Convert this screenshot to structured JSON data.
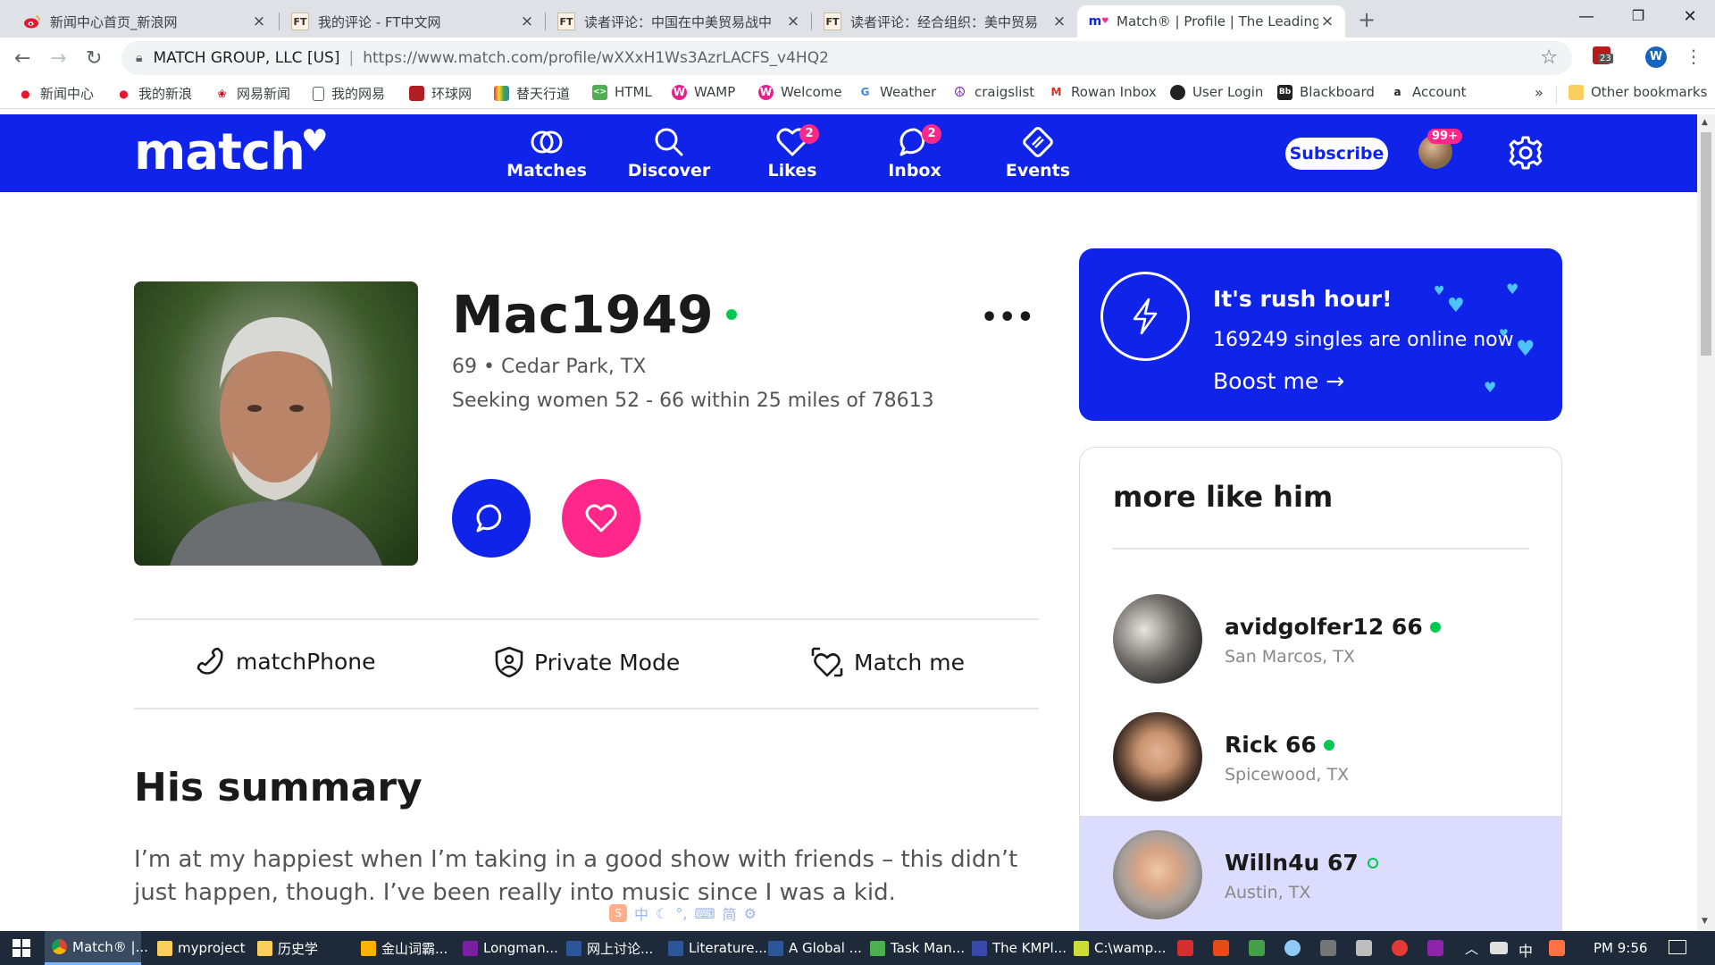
{
  "browser": {
    "tabs": [
      {
        "title": "新闻中心首页_新浪网",
        "favicon": "weibo-icon",
        "active": false
      },
      {
        "title": "我的评论 - FT中文网",
        "favicon": "ft-icon",
        "active": false
      },
      {
        "title": "读者评论：中国在中美贸易战中",
        "favicon": "ft-icon",
        "active": false
      },
      {
        "title": "读者评论：经合组织：美中贸易",
        "favicon": "ft-icon",
        "active": false
      },
      {
        "title": "Match® | Profile | The Leading O",
        "favicon": "match-icon",
        "active": true
      }
    ],
    "new_tab": "+",
    "site_org": "MATCH GROUP, LLC [US]",
    "url": "https://www.match.com/profile/wXXxH1Ws3AzrLACFS_v4HQ2",
    "extension_badge": "23",
    "profile_initial": "W",
    "ft_favicon_text": "FT",
    "bookmarks": [
      {
        "label": "新闻中心",
        "icon": "weibo-icon",
        "color": "#e6162d"
      },
      {
        "label": "我的新浪",
        "icon": "weibo-icon",
        "color": "#e6162d"
      },
      {
        "label": "网易新闻",
        "icon": "netease-icon",
        "color": "#d7000f"
      },
      {
        "label": "我的网易",
        "icon": "page-icon",
        "color": "#5f6368"
      },
      {
        "label": "环球网",
        "icon": "huanqiu-icon",
        "color": "#b01e23"
      },
      {
        "label": "替天行道",
        "icon": "rainbow-icon",
        "color": "#2a9d3a"
      },
      {
        "label": "HTML",
        "icon": "html-icon",
        "color": "#4caf50"
      },
      {
        "label": "WAMP",
        "icon": "wamp-icon",
        "color": "#e91e8c"
      },
      {
        "label": "Welcome",
        "icon": "wamp-icon",
        "color": "#e91e8c"
      },
      {
        "label": "Weather",
        "icon": "google-icon",
        "color": "#4285f4"
      },
      {
        "label": "craigslist",
        "icon": "peace-icon",
        "color": "#7b2fa5"
      },
      {
        "label": "Rowan Inbox",
        "icon": "gmail-icon",
        "color": "#d93025"
      },
      {
        "label": "User Login",
        "icon": "userlogin-icon",
        "color": "#222222"
      },
      {
        "label": "Blackboard",
        "icon": "blackboard-icon",
        "color": "#222222"
      },
      {
        "label": "Account",
        "icon": "amazon-icon",
        "color": "#222222"
      }
    ],
    "bookmarks_overflow": "»",
    "other_bookmarks": "Other bookmarks"
  },
  "site": {
    "logo": "match",
    "nav": [
      {
        "label": "Matches",
        "icon": "matches-icon",
        "badge": ""
      },
      {
        "label": "Discover",
        "icon": "search-icon",
        "badge": ""
      },
      {
        "label": "Likes",
        "icon": "heart-icon",
        "badge": "2"
      },
      {
        "label": "Inbox",
        "icon": "chat-icon",
        "badge": "2"
      },
      {
        "label": "Events",
        "icon": "events-icon",
        "badge": ""
      }
    ],
    "subscribe": "Subscribe",
    "avatar_badge": "99+",
    "brand_color": "#0f24e8",
    "accent_color": "#ff288a"
  },
  "profile": {
    "name": "Mac1949",
    "online": true,
    "info": "69 • Cedar Park, TX",
    "seeking": "Seeking women 52 - 66 within 25 miles of 78613",
    "more": "•••",
    "features": [
      {
        "label": "matchPhone",
        "icon": "phone-icon"
      },
      {
        "label": "Private Mode",
        "icon": "shield-icon"
      },
      {
        "label": "Match me",
        "icon": "matchme-icon"
      }
    ],
    "summary_title": "His summary",
    "summary_text": "I’m at my happiest when I’m taking in a good show with friends – this didn’t just happen, though. I’ve been really into music since I was a kid."
  },
  "rush": {
    "title": "It's rush hour!",
    "line": "169249 singles are online now",
    "cta": "Boost me →"
  },
  "more_like": {
    "title": "more like him",
    "people": [
      {
        "name": "avidgolfer12 66",
        "location": "San Marcos, TX",
        "online": true,
        "highlight": false
      },
      {
        "name": "Rick 66",
        "location": "Spicewood, TX",
        "online": true,
        "highlight": false
      },
      {
        "name": "Willn4u 67",
        "location": "Austin, TX",
        "online": false,
        "highlight": true
      }
    ]
  },
  "taskbar": {
    "items": [
      {
        "label": "Match® |...",
        "icon": "chrome-icon",
        "active": true
      },
      {
        "label": "myproject",
        "icon": "folder-icon",
        "active": false
      },
      {
        "label": "历史学",
        "icon": "folder-icon",
        "active": false
      },
      {
        "label": "金山词霸...",
        "icon": "kingsoft-icon",
        "active": false
      },
      {
        "label": "Longman...",
        "icon": "longman-icon",
        "active": false
      },
      {
        "label": "网上讨论...",
        "icon": "word-icon",
        "active": false
      },
      {
        "label": "Literature...",
        "icon": "word-icon",
        "active": false
      },
      {
        "label": "A Global ...",
        "icon": "word-icon",
        "active": false
      },
      {
        "label": "Task Man...",
        "icon": "taskmanager-icon",
        "active": false
      },
      {
        "label": "The KMPl...",
        "icon": "kmplayer-icon",
        "active": false
      },
      {
        "label": "C:\\wamp...",
        "icon": "notepad-icon",
        "active": false
      }
    ],
    "ime_lang": "中",
    "time": "PM 9:56",
    "ime_bar": [
      "中",
      "☾",
      "°,",
      "⌨",
      "简",
      "⚙"
    ]
  }
}
